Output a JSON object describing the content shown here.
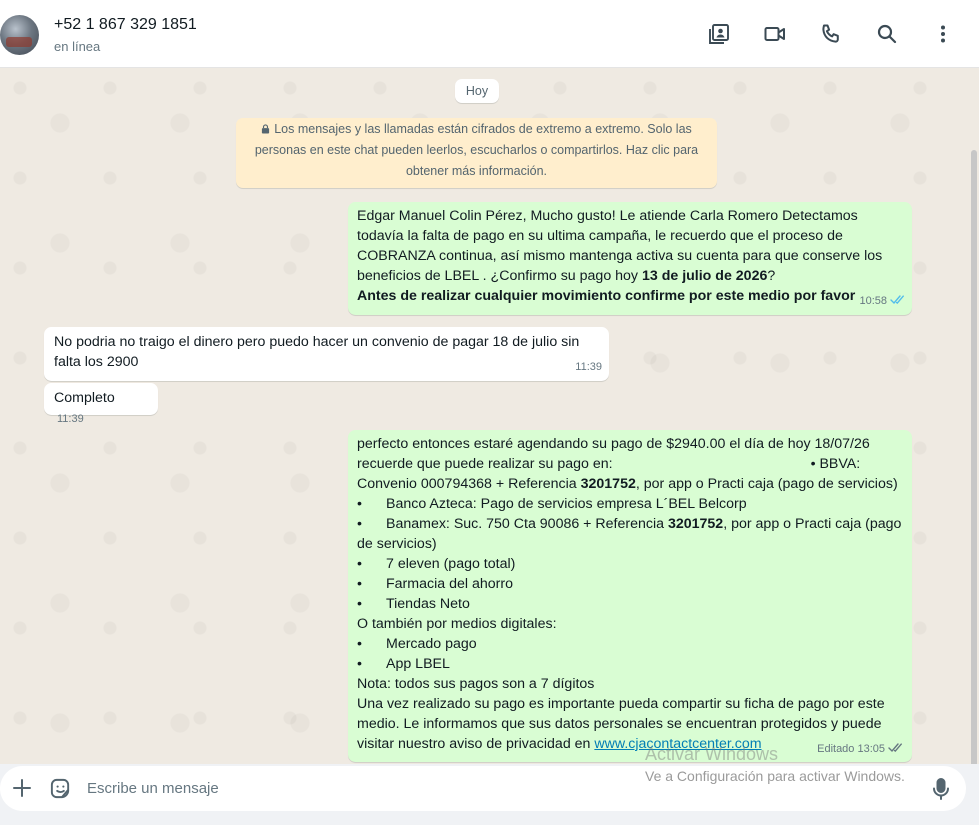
{
  "header": {
    "contact_name": "+52 1 867 329 1851",
    "status": "en línea",
    "icons": [
      "contact-card-icon",
      "video-call-icon",
      "voice-call-icon",
      "search-icon",
      "menu-dots-icon"
    ]
  },
  "chat": {
    "date_chip": "Hoy",
    "encryption_notice": "Los mensajes y las llamadas están cifrados de extremo a extremo. Solo las personas en este chat pueden leerlos, escucharlos o compartirlos. Haz clic para obtener más información.",
    "messages": [
      {
        "direction": "outgoing",
        "parts": {
          "p1": "Edgar Manuel Colin Pérez, Mucho gusto! Le atiende Carla Romero Detectamos todavía la falta de pago en su ultima campaña,  le recuerdo que el proceso de COBRANZA continua, así mismo mantenga activa su cuenta para que conserve los beneficios de LBEL . ¿Confirmo su pago hoy ",
          "date_bold": "13 de julio de 2026",
          "p2": "?",
          "bold_line": "Antes de realizar cualquier movimiento confirme  por este medio por favor"
        },
        "time": "10:58",
        "status": "read"
      },
      {
        "direction": "incoming",
        "text": "No podria no traigo el dinero pero puedo hacer un convenio de pagar 18 de julio sin falta los 2900",
        "time": "11:39"
      },
      {
        "direction": "incoming",
        "text": "Completo",
        "time": "11:39"
      },
      {
        "direction": "outgoing",
        "parts": {
          "l1": "perfecto  entonces estaré agendando su pago de $2940.00 el día de hoy 18/07/26",
          "l2a": "recuerde que puede realizar su pago en:",
          "l2b": "•  BBVA:",
          "l3a": "Convenio 000794368 + Referencia ",
          "ref1": "3201752",
          "l3b": ", por app o Practi caja (pago de servicios)",
          "bullet": "•",
          "l4": "Banco Azteca: Pago de servicios empresa L´BEL Belcorp",
          "l5a": "Banamex: Suc. 750 Cta 90086 + Referencia ",
          "ref2": "3201752",
          "l5b": ", por app o Practi caja (pago de servicios)",
          "l6": "7 eleven (pago total)",
          "l7": "Farmacia del ahorro",
          "l8": "Tiendas Neto",
          "l9": "O también por medios digitales:",
          "l10": "Mercado pago",
          "l11": "App LBEL",
          "l12": "Nota: todos sus pagos son a 7 dígitos",
          "l13": "Una vez realizado su pago es importante pueda compartir su ficha de pago por este medio. Le informamos que sus datos personales se encuentran protegidos y puede visitar nuestro aviso de privacidad en ",
          "link": "www.cjacontactcenter.com"
        },
        "time": "Editado 13:05",
        "status": "delivered"
      }
    ]
  },
  "watermark": {
    "line1": "Activar Windows",
    "line2": "Ve a Configuración para activar Windows."
  },
  "composer": {
    "placeholder": "Escribe un mensaje"
  },
  "colors": {
    "outgoing_bubble": "#d9fdd3",
    "incoming_bubble": "#ffffff",
    "chat_background": "#efeae2",
    "read_ticks": "#53bdeb"
  }
}
